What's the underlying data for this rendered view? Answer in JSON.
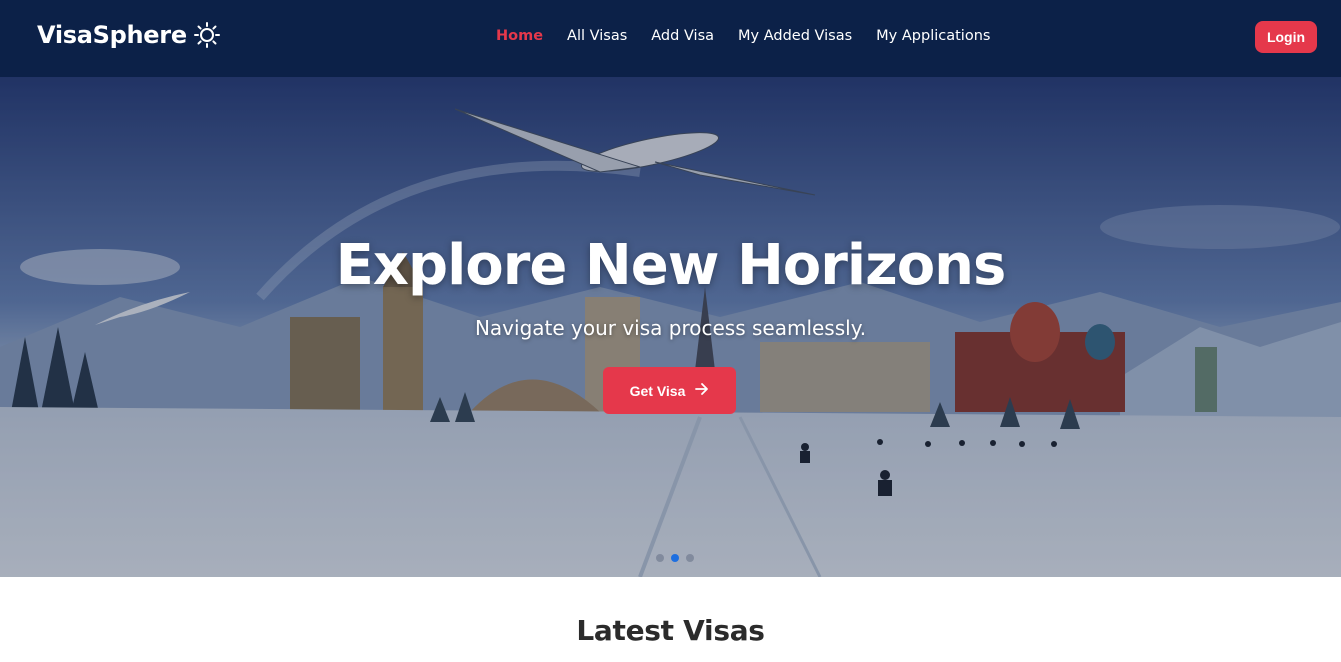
{
  "brand": {
    "name": "VisaSphere",
    "icon": "sun-icon"
  },
  "nav": {
    "items": [
      {
        "label": "Home",
        "active": true
      },
      {
        "label": "All Visas",
        "active": false
      },
      {
        "label": "Add Visa",
        "active": false
      },
      {
        "label": "My Added Visas",
        "active": false
      },
      {
        "label": "My Applications",
        "active": false
      }
    ],
    "login_label": "Login"
  },
  "hero": {
    "title": "Explore New Horizons",
    "subtitle": "Navigate your visa process seamlessly.",
    "cta_label": "Get Visa",
    "cta_icon": "arrow-right-icon",
    "slides_count": 3,
    "active_slide": 2
  },
  "latest": {
    "title": "Latest Visas"
  },
  "colors": {
    "navbar": "#0c2148",
    "accent": "#e5384b",
    "active_dot": "#1e6fe0"
  }
}
